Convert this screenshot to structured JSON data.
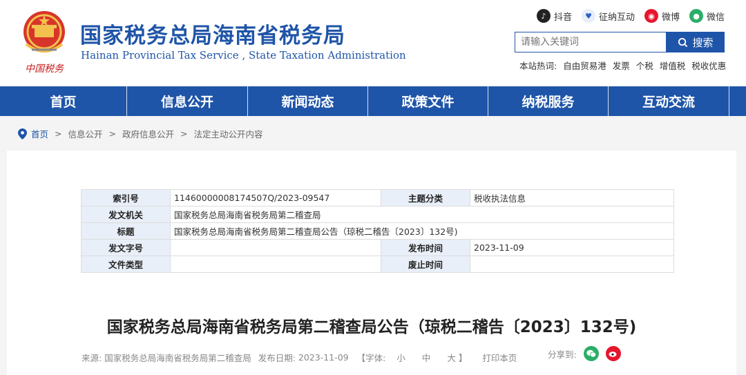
{
  "header": {
    "site_title": "国家税务总局海南省税务局",
    "site_subtitle": "Hainan Provincial Tax Service , State Taxation Administration",
    "logo_text": "中国税务",
    "social": [
      {
        "label": "抖音",
        "icon": "tiktok-icon"
      },
      {
        "label": "征纳互动",
        "icon": "interaction-icon"
      },
      {
        "label": "微博",
        "icon": "weibo-icon"
      },
      {
        "label": "微信",
        "icon": "wechat-icon"
      }
    ],
    "search": {
      "placeholder": "请输入关键词",
      "button_label": "搜索"
    },
    "hotwords": {
      "label": "本站热词:",
      "items": [
        "自由贸易港",
        "发票",
        "个税",
        "增值税",
        "税收优惠"
      ]
    }
  },
  "nav": {
    "items": [
      "首页",
      "信息公开",
      "新闻动态",
      "政策文件",
      "纳税服务",
      "互动交流"
    ]
  },
  "breadcrumb": {
    "items": [
      "首页",
      "信息公开",
      "政府信息公开",
      "法定主动公开内容"
    ],
    "separator": ">"
  },
  "meta": {
    "index_no_label": "索引号",
    "index_no": "11460000008174507Q/2023-09547",
    "topic_label": "主题分类",
    "topic": "税收执法信息",
    "issuer_label": "发文机关",
    "issuer": "国家税务总局海南省税务局第二稽查局",
    "title_label": "标题",
    "title": "国家税务总局海南省税务局第二稽查局公告（琼税二稽告〔2023〕132号)",
    "doc_no_label": "发文字号",
    "doc_no": "",
    "pub_date_label": "发布时间",
    "pub_date": "2023-11-09",
    "doc_type_label": "文件类型",
    "doc_type": "",
    "expire_label": "废止时间",
    "expire": ""
  },
  "article": {
    "title": "国家税务总局海南省税务局第二稽查局公告（琼税二稽告〔2023〕132号)",
    "source_label": "来源:",
    "source": "国家税务总局海南省税务局第二稽查局",
    "date_label": "发布日期:",
    "date": "2023-11-09",
    "font_label": "【字体:",
    "font_small": "小",
    "font_medium": "中",
    "font_large": "大",
    "font_close": "】",
    "print_label": "打印本页",
    "share_label": "分享到:"
  },
  "colors": {
    "brand_blue": "#1f55a8",
    "wechat_green": "#2aae67",
    "weibo_red": "#e6162d"
  }
}
